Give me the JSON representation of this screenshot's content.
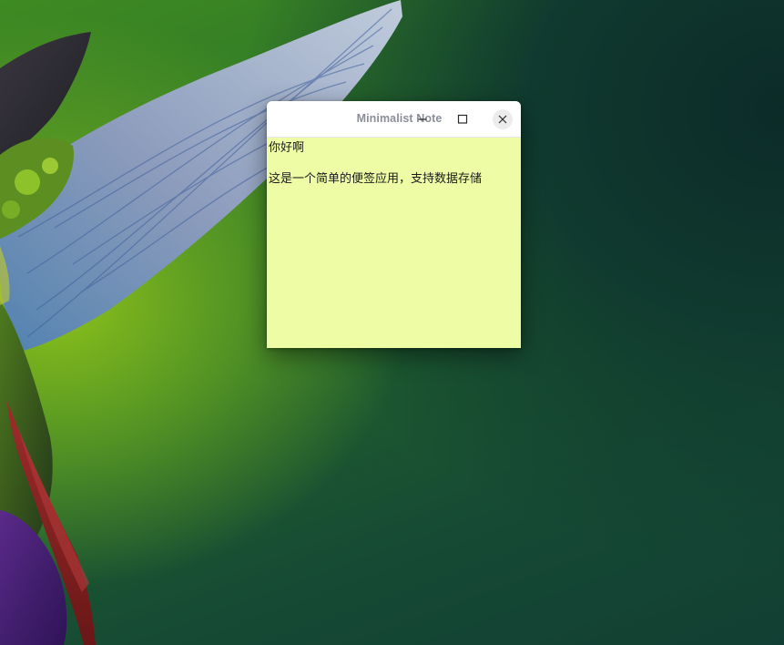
{
  "window": {
    "title": "Minimalist Note",
    "controls": {
      "minimize_icon": "minimize-icon",
      "maximize_icon": "maximize-icon",
      "close_icon": "close-icon"
    }
  },
  "note": {
    "background_color": "#eefca6",
    "lines": [
      "你好啊",
      "",
      "这是一个简单的便签应用，支持数据存储"
    ]
  },
  "desktop": {
    "wallpaper": "hummingbird-wallpaper"
  }
}
